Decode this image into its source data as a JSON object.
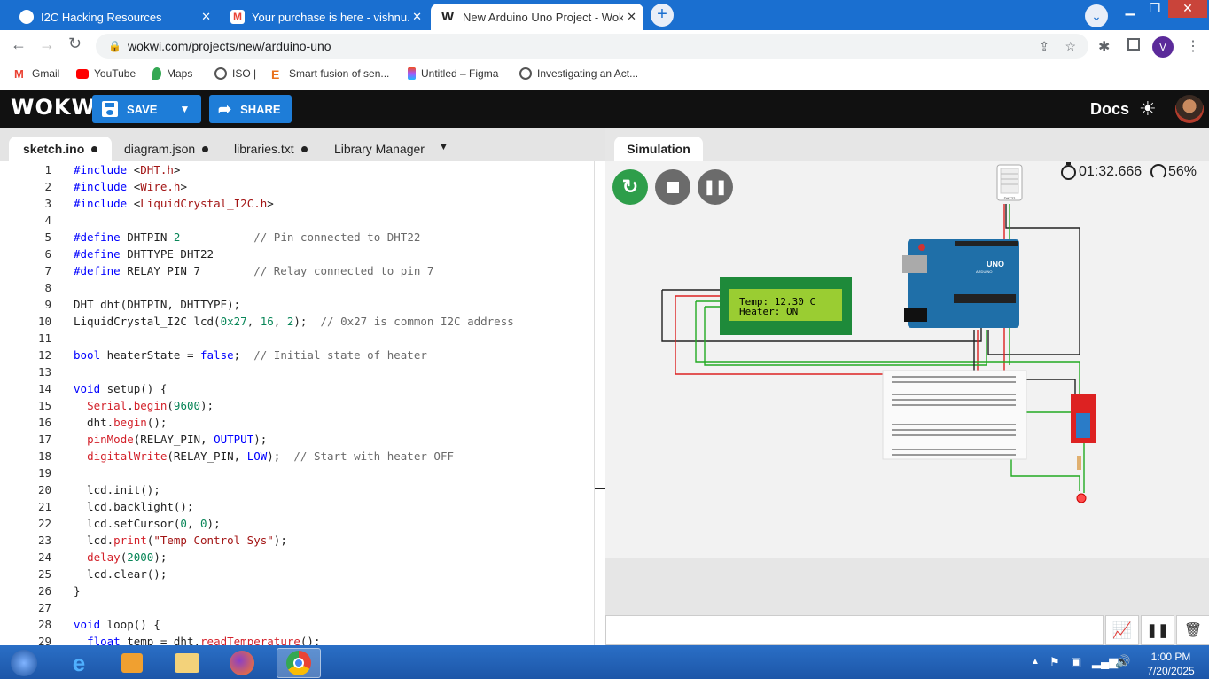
{
  "browser": {
    "tabs": [
      {
        "title": "I2C Hacking Resources",
        "icon": "github-icon",
        "color": "#ffffff"
      },
      {
        "title": "Your purchase is here - vishnu.ps",
        "icon": "gmail-icon",
        "color": "#ea4335"
      },
      {
        "title": "New Arduino Uno Project - Wokwi",
        "icon": "wokwi-icon",
        "color": "#222222"
      }
    ],
    "url": "wokwi.com/projects/new/arduino-uno",
    "profile_initial": "V",
    "bookmarks": [
      "Gmail",
      "YouTube",
      "Maps",
      "ISO |",
      "Smart fusion of sen...",
      "Untitled – Figma",
      "Investigating an Act..."
    ]
  },
  "wokwi": {
    "logo": "WOKWi",
    "save_label": "SAVE",
    "share_label": "SHARE",
    "docs_label": "Docs",
    "accent": "#1e7dd8"
  },
  "editor": {
    "tabs": [
      "sketch.ino",
      "diagram.json",
      "libraries.txt",
      "Library Manager"
    ],
    "line_numbers": [
      "1",
      "2",
      "3",
      "4",
      "5",
      "6",
      "7",
      "8",
      "9",
      "10",
      "11",
      "12",
      "13",
      "14",
      "15",
      "16",
      "17",
      "18",
      "19",
      "20",
      "21",
      "22",
      "23",
      "24",
      "25",
      "26",
      "27",
      "28",
      "29"
    ],
    "lines": [
      "#include <DHT.h>",
      "#include <Wire.h>",
      "#include <LiquidCrystal_I2C.h>",
      "",
      "#define DHTPIN 2           // Pin connected to DHT22",
      "#define DHTTYPE DHT22",
      "#define RELAY_PIN 7        // Relay connected to pin 7",
      "",
      "DHT dht(DHTPIN, DHTTYPE);",
      "LiquidCrystal_I2C lcd(0x27, 16, 2);  // 0x27 is common I2C address",
      "",
      "bool heaterState = false;  // Initial state of heater",
      "",
      "void setup() {",
      "  Serial.begin(9600);",
      "  dht.begin();",
      "  pinMode(RELAY_PIN, OUTPUT);",
      "  digitalWrite(RELAY_PIN, LOW);  // Start with heater OFF",
      "",
      "  lcd.init();",
      "  lcd.backlight();",
      "  lcd.setCursor(0, 0);",
      "  lcd.print(\"Temp Control Sys\");",
      "  delay(2000);",
      "  lcd.clear();",
      "}",
      "",
      "void loop() {",
      "  float temp = dht.readTemperature();"
    ]
  },
  "simulation": {
    "tab_label": "Simulation",
    "timer": "01:32.666",
    "speed": "56%",
    "lcd_line1": "Temp: 12.30 C",
    "lcd_line2": "Heater: ON",
    "dht_label": "DHT22",
    "uno_label": "UNO",
    "arduino_label": "ARDUINO"
  },
  "taskbar": {
    "time": "1:00 PM",
    "date": "7/20/2025"
  }
}
